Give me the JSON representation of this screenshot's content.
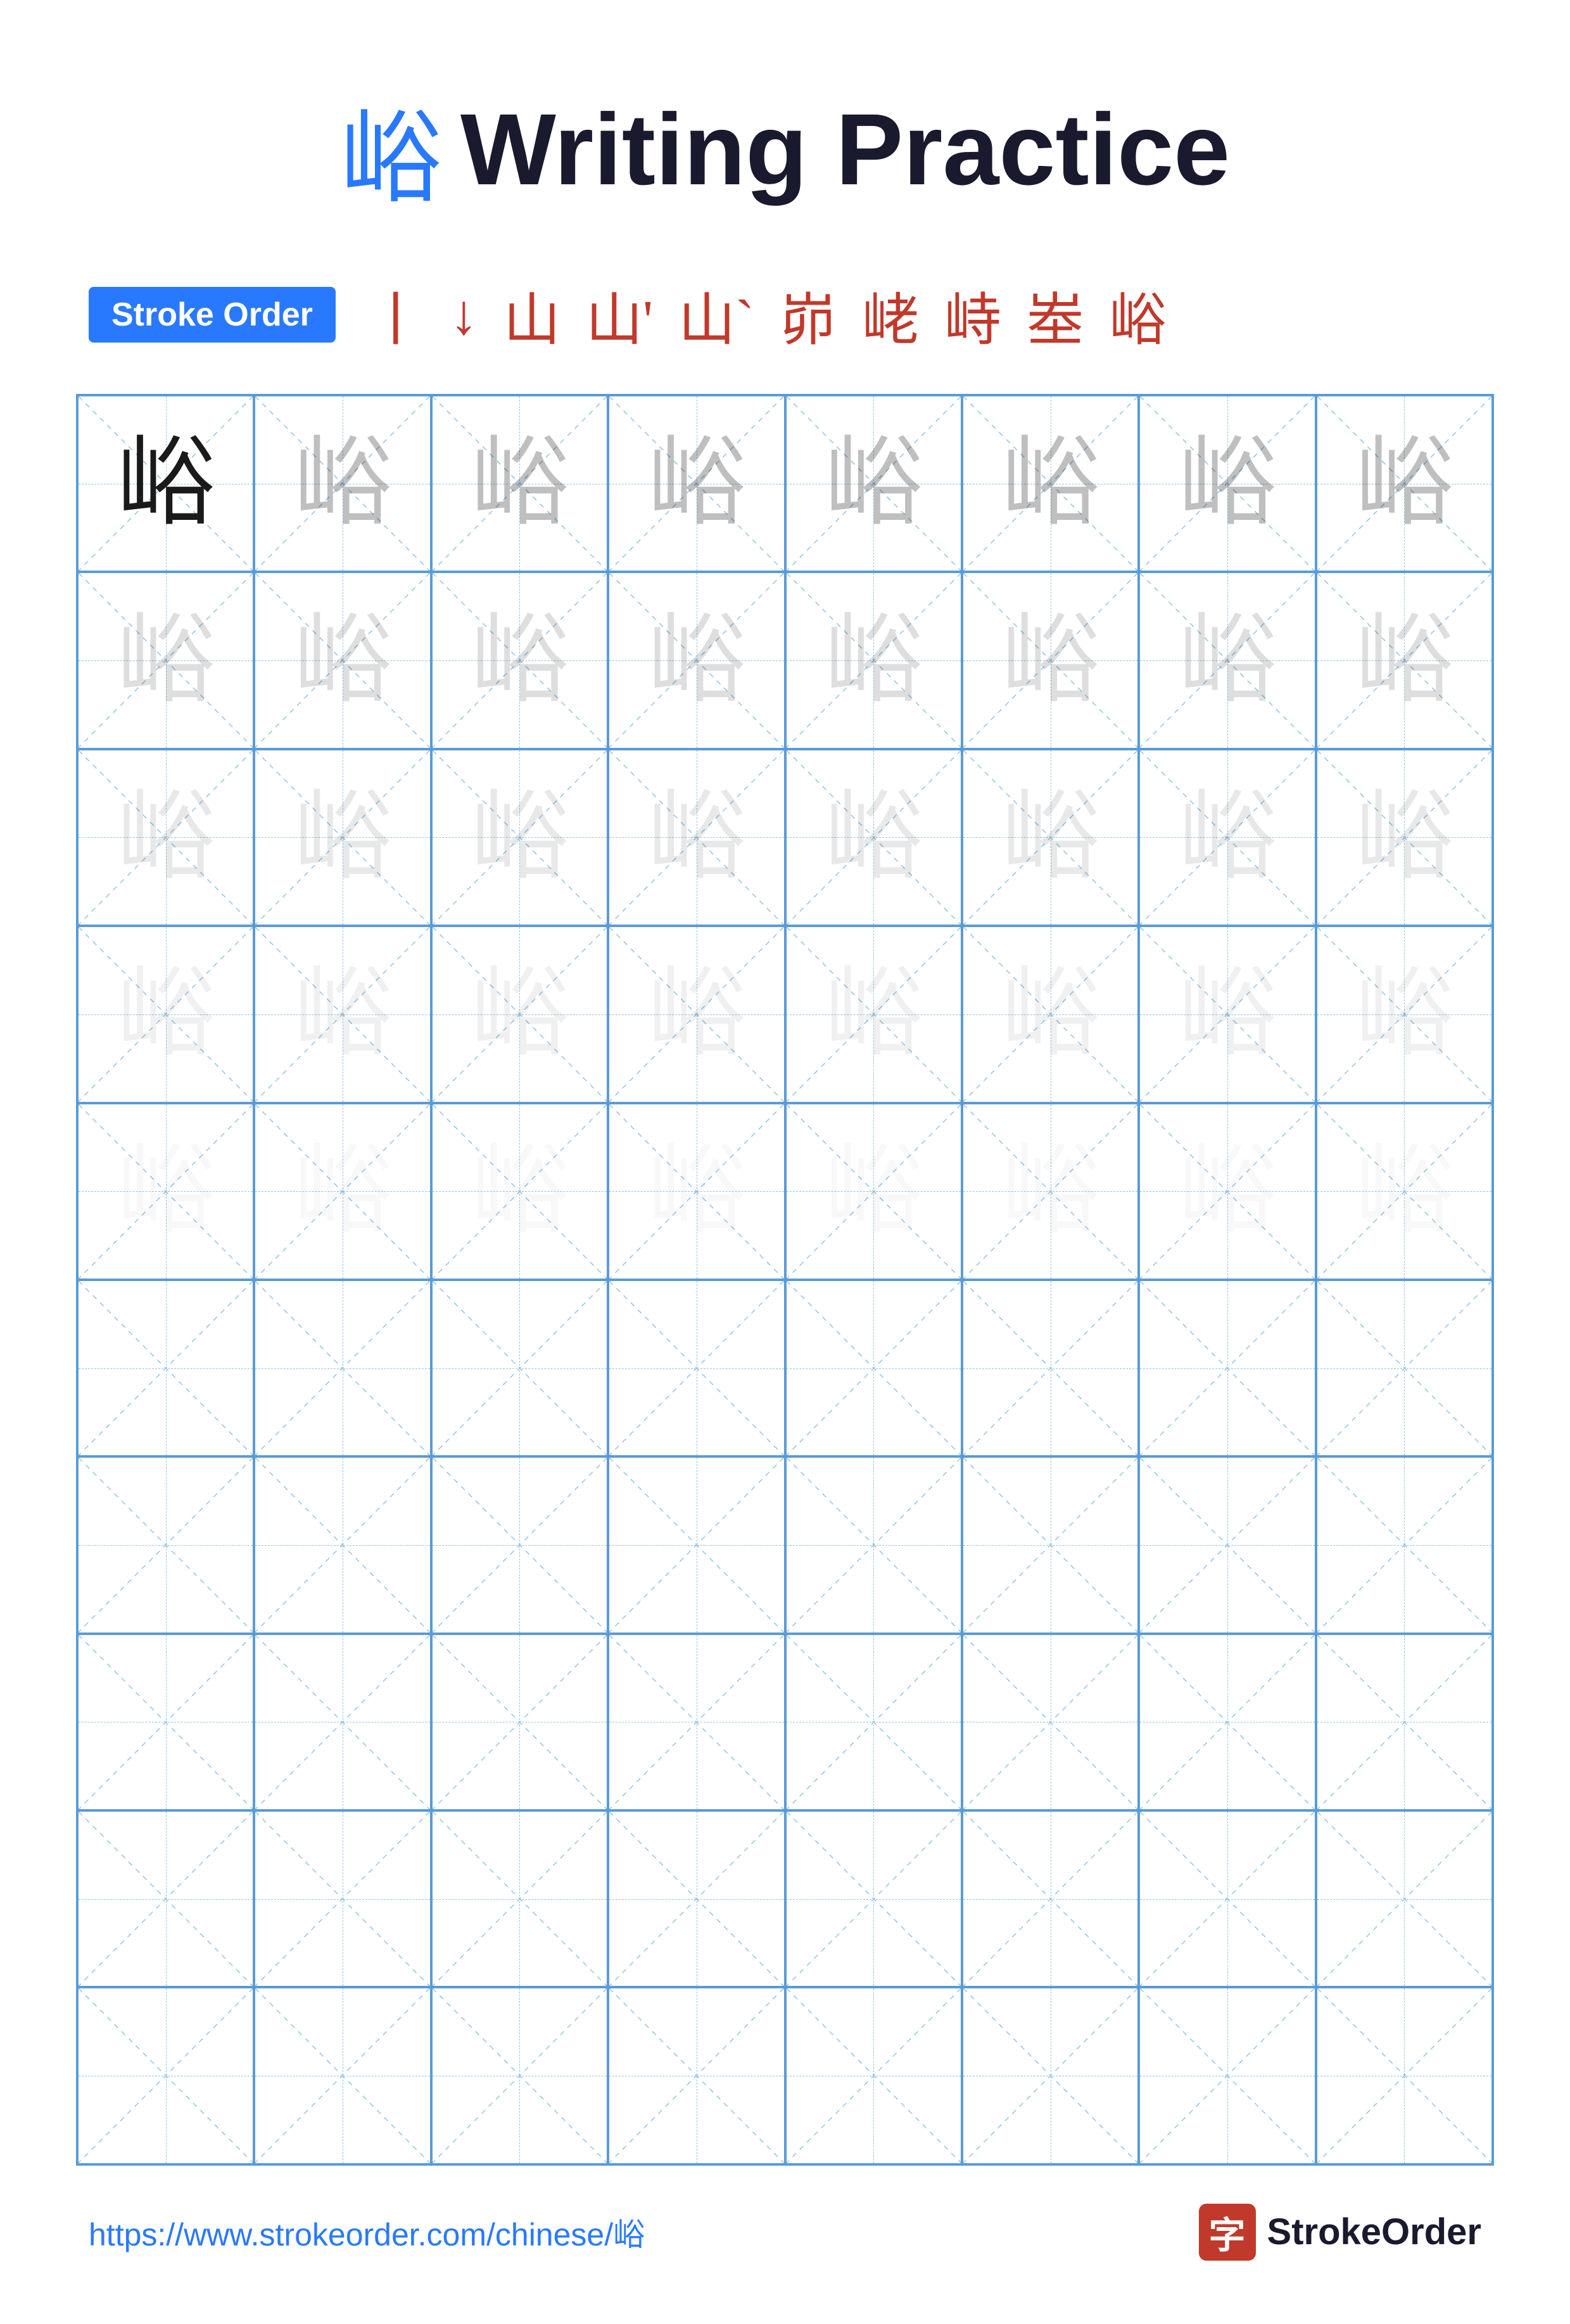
{
  "title": {
    "char": "峪",
    "text": "Writing Practice"
  },
  "stroke_order": {
    "badge_label": "Stroke Order",
    "strokes": [
      "丨",
      "↓",
      "山",
      "山'",
      "山`",
      "峁",
      "峔",
      "峙",
      "峚",
      "峪"
    ]
  },
  "grid": {
    "rows": 10,
    "cols": 8,
    "char": "峪",
    "row_types": [
      "dark",
      "medium",
      "light",
      "lighter",
      "lightest",
      "empty",
      "empty",
      "empty",
      "empty",
      "empty"
    ]
  },
  "footer": {
    "url": "https://www.strokeorder.com/chinese/峪",
    "brand_char": "字",
    "brand_name": "StrokeOrder"
  }
}
